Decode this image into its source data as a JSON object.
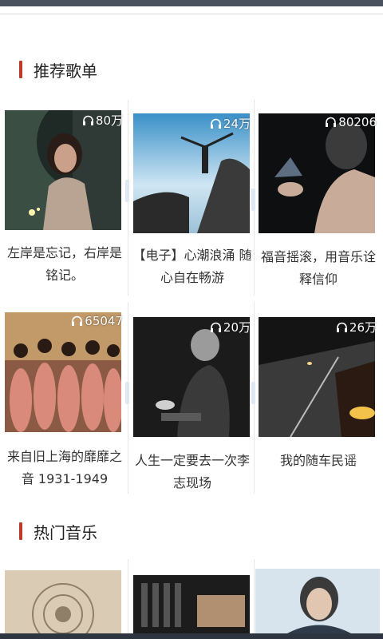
{
  "sections": {
    "recommended": {
      "title": "推荐歌单"
    },
    "hot": {
      "title": "热门音乐"
    }
  },
  "playlists": [
    {
      "title": "左岸是忘记，右岸是铭记。",
      "plays": "80万"
    },
    {
      "title": "【电子】心潮浪涌 随心自在畅游",
      "plays": "24万"
    },
    {
      "title": "福音摇滚，用音乐诠释信仰",
      "plays": "80206"
    },
    {
      "title": "来自旧上海的靡靡之音 1931-1949",
      "plays": "65047"
    },
    {
      "title": "人生一定要去一次李志现场",
      "plays": "20万"
    },
    {
      "title": "我的随车民谣",
      "plays": "26万"
    }
  ],
  "icons": {
    "play_count": "headphones-icon",
    "section_marker": "red-bar"
  },
  "colors": {
    "accent": "#c0392b",
    "statusbar": "#4a5260"
  }
}
